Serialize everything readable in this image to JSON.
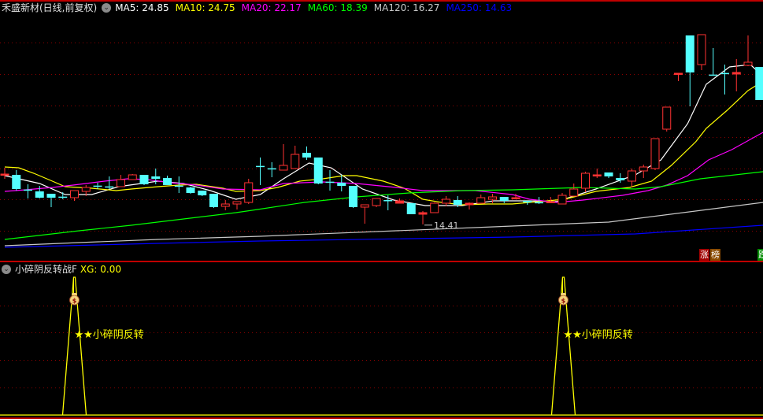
{
  "main_panel": {
    "title": "禾盛新材(日线,前复权)",
    "collapse_icon": "chevron-down-icon",
    "ma_legend": [
      {
        "label": "MA5: 24.85",
        "color": "#ffffff"
      },
      {
        "label": "MA10: 24.75",
        "color": "#ffff00"
      },
      {
        "label": "MA20: 22.17",
        "color": "#ff00ff"
      },
      {
        "label": "MA60: 18.39",
        "color": "#00ff00"
      },
      {
        "label": "MA120: 16.27",
        "color": "#c8c8c8"
      },
      {
        "label": "MA250: 14.63",
        "color": "#0000ff"
      }
    ],
    "low_marker": "14.41",
    "tags": [
      {
        "label": "涨",
        "color": "#a00000"
      },
      {
        "label": "榜",
        "color": "#8a4a00"
      },
      {
        "label": "跌",
        "color": "#008a00"
      }
    ]
  },
  "indicator_panel": {
    "title": "小碎阴反转战F",
    "value_label": "XG: 0.00",
    "signal_text": "★★小碎阴反转",
    "signal_icon": "money-bag-icon",
    "signal_indices": [
      6,
      48.1
    ]
  },
  "colors": {
    "up": "#ff3232",
    "down": "#54ffff",
    "grid": "#8b0000",
    "separator": "#c00000",
    "signal": "#ffff00"
  },
  "chart_data": {
    "type": "candlestick",
    "price_range": [
      12.0,
      31.5
    ],
    "candles_ohlc": [
      [
        18.18,
        18.72,
        17.88,
        18.24
      ],
      [
        18.18,
        18.54,
        16.98,
        17.1
      ],
      [
        17.06,
        17.46,
        16.38,
        17.04
      ],
      [
        16.92,
        17.34,
        16.38,
        16.44
      ],
      [
        16.74,
        16.74,
        15.72,
        16.44
      ],
      [
        16.52,
        16.86,
        16.32,
        16.5
      ],
      [
        16.44,
        16.98,
        16.2,
        16.98
      ],
      [
        16.92,
        17.4,
        16.56,
        17.22
      ],
      [
        17.36,
        17.58,
        17.1,
        17.34
      ],
      [
        17.3,
        18.06,
        17.1,
        17.28
      ],
      [
        17.28,
        18.18,
        17.28,
        17.82
      ],
      [
        17.82,
        18.24,
        17.82,
        18.18
      ],
      [
        18.18,
        18.18,
        17.4,
        17.46
      ],
      [
        18.06,
        18.66,
        17.46,
        17.88
      ],
      [
        17.94,
        18.12,
        17.4,
        17.4
      ],
      [
        17.36,
        18.06,
        16.8,
        17.34
      ],
      [
        17.22,
        17.28,
        16.74,
        16.8
      ],
      [
        16.98,
        16.98,
        16.56,
        16.62
      ],
      [
        16.74,
        16.74,
        15.66,
        15.72
      ],
      [
        15.78,
        16.26,
        15.48,
        15.96
      ],
      [
        15.96,
        16.14,
        15.54,
        16.14
      ],
      [
        16.08,
        17.88,
        15.96,
        17.58
      ],
      [
        18.86,
        19.5,
        17.4,
        18.84
      ],
      [
        18.68,
        19.14,
        18.0,
        18.66
      ],
      [
        18.54,
        20.52,
        18.54,
        18.9
      ],
      [
        18.66,
        20.4,
        18.66,
        19.74
      ],
      [
        19.86,
        20.34,
        19.32,
        19.5
      ],
      [
        19.5,
        19.5,
        17.46,
        17.52
      ],
      [
        17.66,
        18.54,
        16.98,
        17.64
      ],
      [
        17.58,
        18.18,
        16.92,
        17.34
      ],
      [
        17.34,
        17.34,
        15.66,
        15.72
      ],
      [
        15.72,
        15.9,
        14.46,
        15.9
      ],
      [
        15.84,
        16.38,
        15.72,
        16.38
      ],
      [
        16.26,
        16.62,
        15.48,
        16.24
      ],
      [
        16.02,
        16.38,
        16.02,
        16.2
      ],
      [
        16.02,
        16.02,
        15.18,
        15.18
      ],
      [
        15.18,
        15.42,
        14.41,
        15.3
      ],
      [
        15.3,
        16.08,
        15.3,
        16.02
      ],
      [
        16.02,
        16.56,
        15.78,
        16.32
      ],
      [
        16.26,
        16.56,
        15.72,
        15.9
      ],
      [
        15.9,
        16.08,
        15.54,
        16.02
      ],
      [
        16.02,
        16.68,
        16.02,
        16.44
      ],
      [
        16.32,
        16.74,
        16.02,
        16.5
      ],
      [
        16.5,
        16.5,
        16.02,
        16.2
      ],
      [
        16.44,
        16.74,
        16.32,
        16.44
      ],
      [
        16.2,
        16.2,
        15.9,
        16.08
      ],
      [
        16.1,
        16.5,
        15.96,
        16.08
      ],
      [
        16.14,
        16.5,
        16.08,
        16.14
      ],
      [
        15.96,
        16.8,
        15.96,
        16.62
      ],
      [
        16.56,
        17.52,
        16.56,
        17.1
      ],
      [
        17.16,
        18.42,
        16.86,
        18.3
      ],
      [
        18.16,
        18.66,
        17.94,
        18.18
      ],
      [
        18.36,
        18.36,
        17.94,
        18.06
      ],
      [
        17.94,
        18.3,
        17.58,
        17.76
      ],
      [
        17.7,
        18.66,
        17.22,
        18.48
      ],
      [
        18.48,
        18.96,
        17.94,
        18.78
      ],
      [
        18.66,
        20.94,
        18.54,
        20.94
      ],
      [
        21.66,
        23.34,
        21.48,
        23.34
      ],
      [
        25.88,
        25.92,
        25.32,
        25.92
      ],
      [
        28.8,
        28.8,
        23.4,
        25.98
      ],
      [
        26.58,
        28.86,
        26.16,
        28.86
      ],
      [
        25.82,
        27.84,
        25.8,
        25.8
      ],
      [
        25.94,
        26.58,
        24.3,
        25.92
      ],
      [
        25.86,
        27.0,
        24.54,
        25.98
      ],
      [
        26.52,
        28.8,
        26.46,
        26.76
      ],
      [
        26.4,
        26.4,
        23.88,
        23.88
      ]
    ],
    "moving_averages": [
      {
        "name": "MA5",
        "color": "#ffffff",
        "points": [
          [
            0,
            18.12
          ],
          [
            3,
            17.52
          ],
          [
            5.2,
            16.68
          ],
          [
            7.5,
            16.68
          ],
          [
            9.8,
            17.28
          ],
          [
            13.2,
            17.7
          ],
          [
            15.4,
            17.52
          ],
          [
            17.7,
            16.98
          ],
          [
            19.9,
            16.32
          ],
          [
            22,
            16.68
          ],
          [
            24,
            17.88
          ],
          [
            26.2,
            19.08
          ],
          [
            28.1,
            18.72
          ],
          [
            30.8,
            17.1
          ],
          [
            33.5,
            16.26
          ],
          [
            36.2,
            15.84
          ],
          [
            39.4,
            15.84
          ],
          [
            42.1,
            16.2
          ],
          [
            45.2,
            16.2
          ],
          [
            47.5,
            16.14
          ],
          [
            50.9,
            17.1
          ],
          [
            54.3,
            18.18
          ],
          [
            56.5,
            19.32
          ],
          [
            58.8,
            22.08
          ],
          [
            60.4,
            25.08
          ],
          [
            62.4,
            26.4
          ],
          [
            64.2,
            26.58
          ],
          [
            65.3,
            25.68
          ]
        ]
      },
      {
        "name": "MA10",
        "color": "#ffff00",
        "points": [
          [
            0,
            18.78
          ],
          [
            1.2,
            18.72
          ],
          [
            2.5,
            18.3
          ],
          [
            4.1,
            17.7
          ],
          [
            5.2,
            17.28
          ],
          [
            7.5,
            17.16
          ],
          [
            9.6,
            16.98
          ],
          [
            10.9,
            17.1
          ],
          [
            13.2,
            17.28
          ],
          [
            15,
            17.4
          ],
          [
            16.5,
            17.46
          ],
          [
            18.8,
            17.16
          ],
          [
            19.9,
            16.92
          ],
          [
            22,
            16.98
          ],
          [
            23.5,
            17.22
          ],
          [
            25.4,
            17.7
          ],
          [
            27.4,
            17.88
          ],
          [
            29.2,
            18.12
          ],
          [
            30.3,
            18.12
          ],
          [
            32.6,
            17.7
          ],
          [
            34.4,
            17.16
          ],
          [
            36,
            16.32
          ],
          [
            37.6,
            16.08
          ],
          [
            39.4,
            15.9
          ],
          [
            41.6,
            15.96
          ],
          [
            43.7,
            15.96
          ],
          [
            45.2,
            16.08
          ],
          [
            48.2,
            16.32
          ],
          [
            50.9,
            16.92
          ],
          [
            53.8,
            17.22
          ],
          [
            55.7,
            17.7
          ],
          [
            57.4,
            18.9
          ],
          [
            59.5,
            20.7
          ],
          [
            60.4,
            21.72
          ],
          [
            62.2,
            23.1
          ],
          [
            64,
            24.6
          ],
          [
            65.3,
            25.32
          ]
        ]
      },
      {
        "name": "MA20",
        "color": "#ff00ff",
        "points": [
          [
            0,
            16.92
          ],
          [
            1.8,
            17.04
          ],
          [
            4.1,
            17.22
          ],
          [
            5.9,
            17.4
          ],
          [
            8.6,
            17.7
          ],
          [
            10.6,
            17.88
          ],
          [
            12.3,
            17.82
          ],
          [
            14.3,
            17.58
          ],
          [
            16.5,
            17.4
          ],
          [
            18.8,
            17.1
          ],
          [
            22,
            17.04
          ],
          [
            24,
            17.52
          ],
          [
            27.4,
            17.64
          ],
          [
            30.3,
            17.52
          ],
          [
            33.7,
            17.22
          ],
          [
            36,
            16.98
          ],
          [
            40.5,
            16.98
          ],
          [
            43.7,
            16.68
          ],
          [
            45.2,
            16.32
          ],
          [
            47.5,
            16.08
          ],
          [
            49.8,
            16.26
          ],
          [
            53.2,
            16.62
          ],
          [
            55.4,
            16.98
          ],
          [
            57,
            17.4
          ],
          [
            58.8,
            18.12
          ],
          [
            60.6,
            19.32
          ],
          [
            62.6,
            20.1
          ],
          [
            65.3,
            21.42
          ]
        ]
      },
      {
        "name": "MA60",
        "color": "#00ff00",
        "points": [
          [
            0,
            13.26
          ],
          [
            6.4,
            13.92
          ],
          [
            10.9,
            14.34
          ],
          [
            15.4,
            14.82
          ],
          [
            19.9,
            15.3
          ],
          [
            21.3,
            15.48
          ],
          [
            25.8,
            16.08
          ],
          [
            30.3,
            16.5
          ],
          [
            34.8,
            16.8
          ],
          [
            39.4,
            16.98
          ],
          [
            43.7,
            17.04
          ],
          [
            49.8,
            17.22
          ],
          [
            54.3,
            17.1
          ],
          [
            56.5,
            17.28
          ],
          [
            59.9,
            17.88
          ],
          [
            65.3,
            18.42
          ]
        ]
      },
      {
        "name": "MA120",
        "color": "#c8c8c8",
        "points": [
          [
            0,
            12.78
          ],
          [
            6.4,
            13.02
          ],
          [
            13.2,
            13.26
          ],
          [
            22,
            13.5
          ],
          [
            43.7,
            14.28
          ],
          [
            52,
            14.58
          ],
          [
            65.3,
            16.08
          ]
        ]
      },
      {
        "name": "MA250",
        "color": "#0000ff",
        "points": [
          [
            0,
            12.66
          ],
          [
            13.2,
            12.96
          ],
          [
            22,
            13.14
          ],
          [
            43.7,
            13.44
          ],
          [
            54.3,
            13.68
          ],
          [
            65.3,
            14.34
          ]
        ]
      }
    ],
    "indicator": {
      "name": "XG",
      "range": [
        0,
        1
      ],
      "spike_value": 1
    }
  }
}
